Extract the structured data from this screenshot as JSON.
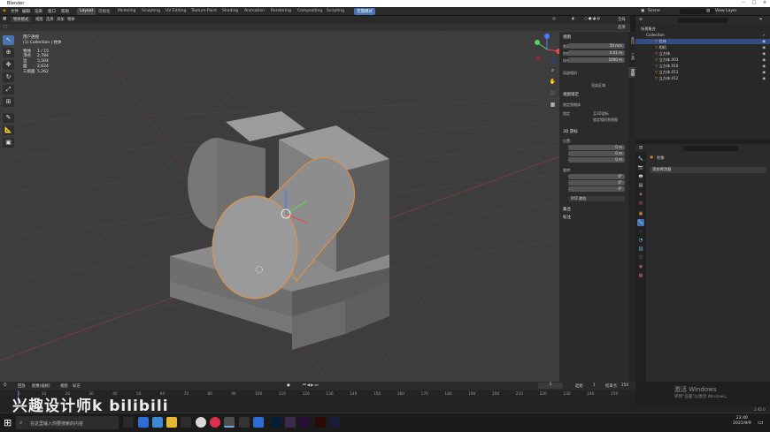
{
  "window": {
    "title": "Blender"
  },
  "menu": [
    "文件",
    "编辑",
    "渲染",
    "窗口",
    "帮助"
  ],
  "workspaces": [
    "Layout",
    "可视化",
    "Modeling",
    "Sculpting",
    "UV Editing",
    "Texture Paint",
    "Shading",
    "Animation",
    "Rendering",
    "Compositing",
    "Scripting"
  ],
  "workspace_extra": "无需模式",
  "top_right": {
    "scene_label": "Scene",
    "view_layer": "View Layer"
  },
  "viewport": {
    "header": [
      "物体模式",
      "视图",
      "选择",
      "添加",
      "物体"
    ],
    "header_right": "全局",
    "mode_bar": [
      "选项"
    ],
    "overlay_lines": [
      "用户透视",
      "(1) Collection | 柱体"
    ],
    "stats": [
      {
        "k": "物体",
        "v": "1 / 15"
      },
      {
        "k": "顶点",
        "v": "2,784"
      },
      {
        "k": "边",
        "v": "5,504"
      },
      {
        "k": "面",
        "v": "2,624"
      },
      {
        "k": "三角面",
        "v": "5,262"
      }
    ]
  },
  "npanel": {
    "view_header": "视图",
    "fields": [
      {
        "k": "焦距",
        "v": "50 mm"
      },
      {
        "k": "剪裁起点",
        "v": "0.01 m"
      },
      {
        "k": "结束点",
        "v": "1000 m"
      }
    ],
    "local_camera": "局部相机",
    "render_region": "渲染区域",
    "view_lock": "视图锁定",
    "lock_to_obj": "锁定到物体",
    "lock": "锁定",
    "lock_opts": [
      "至3D游标",
      "锁定相机到视图"
    ],
    "cursor_header": "3D 游标",
    "location": "位置:",
    "xyz_loc": [
      {
        "k": "X",
        "v": "0 m"
      },
      {
        "k": "Y",
        "v": "0 m"
      },
      {
        "k": "Z",
        "v": "0 m"
      }
    ],
    "rotation": "旋转:",
    "xyz_rot": [
      {
        "k": "X",
        "v": "0°"
      },
      {
        "k": "Y",
        "v": "0°"
      },
      {
        "k": "Z",
        "v": "0°"
      }
    ],
    "rot_mode": "XYZ 欧拉",
    "collections": "集合",
    "annotation": "标注",
    "tabs": [
      "条目",
      "工具",
      "视图"
    ]
  },
  "outliner": {
    "header": "场景集合",
    "collection": "Collection",
    "items": [
      "柱体",
      "相机",
      "立方体",
      "立方体.003",
      "立方体.010",
      "立方体.011",
      "立方体.012"
    ]
  },
  "properties": {
    "search_placeholder": "",
    "header": "柱体",
    "field": "添加修改器"
  },
  "timeline": {
    "menus": [
      "回放",
      "抠像(插帧)",
      "视图",
      "标记"
    ],
    "current_frame": "1",
    "start_label": "起始",
    "start": "1",
    "end_label": "结束点",
    "end": "250",
    "ticks": [
      "0",
      "10",
      "20",
      "30",
      "40",
      "50",
      "60",
      "70",
      "80",
      "90",
      "100",
      "110",
      "120",
      "130",
      "140",
      "150",
      "160",
      "170",
      "180",
      "190",
      "200",
      "210",
      "220",
      "230",
      "240",
      "250"
    ]
  },
  "status": {
    "version": "2.92.0"
  },
  "activate": {
    "title": "激活 Windows",
    "sub": "转到“设置”以激活 Windows。"
  },
  "watermark": "兴趣设计师k bilibili",
  "taskbar": {
    "search_placeholder": "在这里输入你要搜索的内容",
    "time": "23:40",
    "date": "2021/9/9"
  },
  "colors": {
    "accent": "#4772b3",
    "selection_outline": "#e8913a",
    "viewport_bg": "#3d3d3d"
  }
}
